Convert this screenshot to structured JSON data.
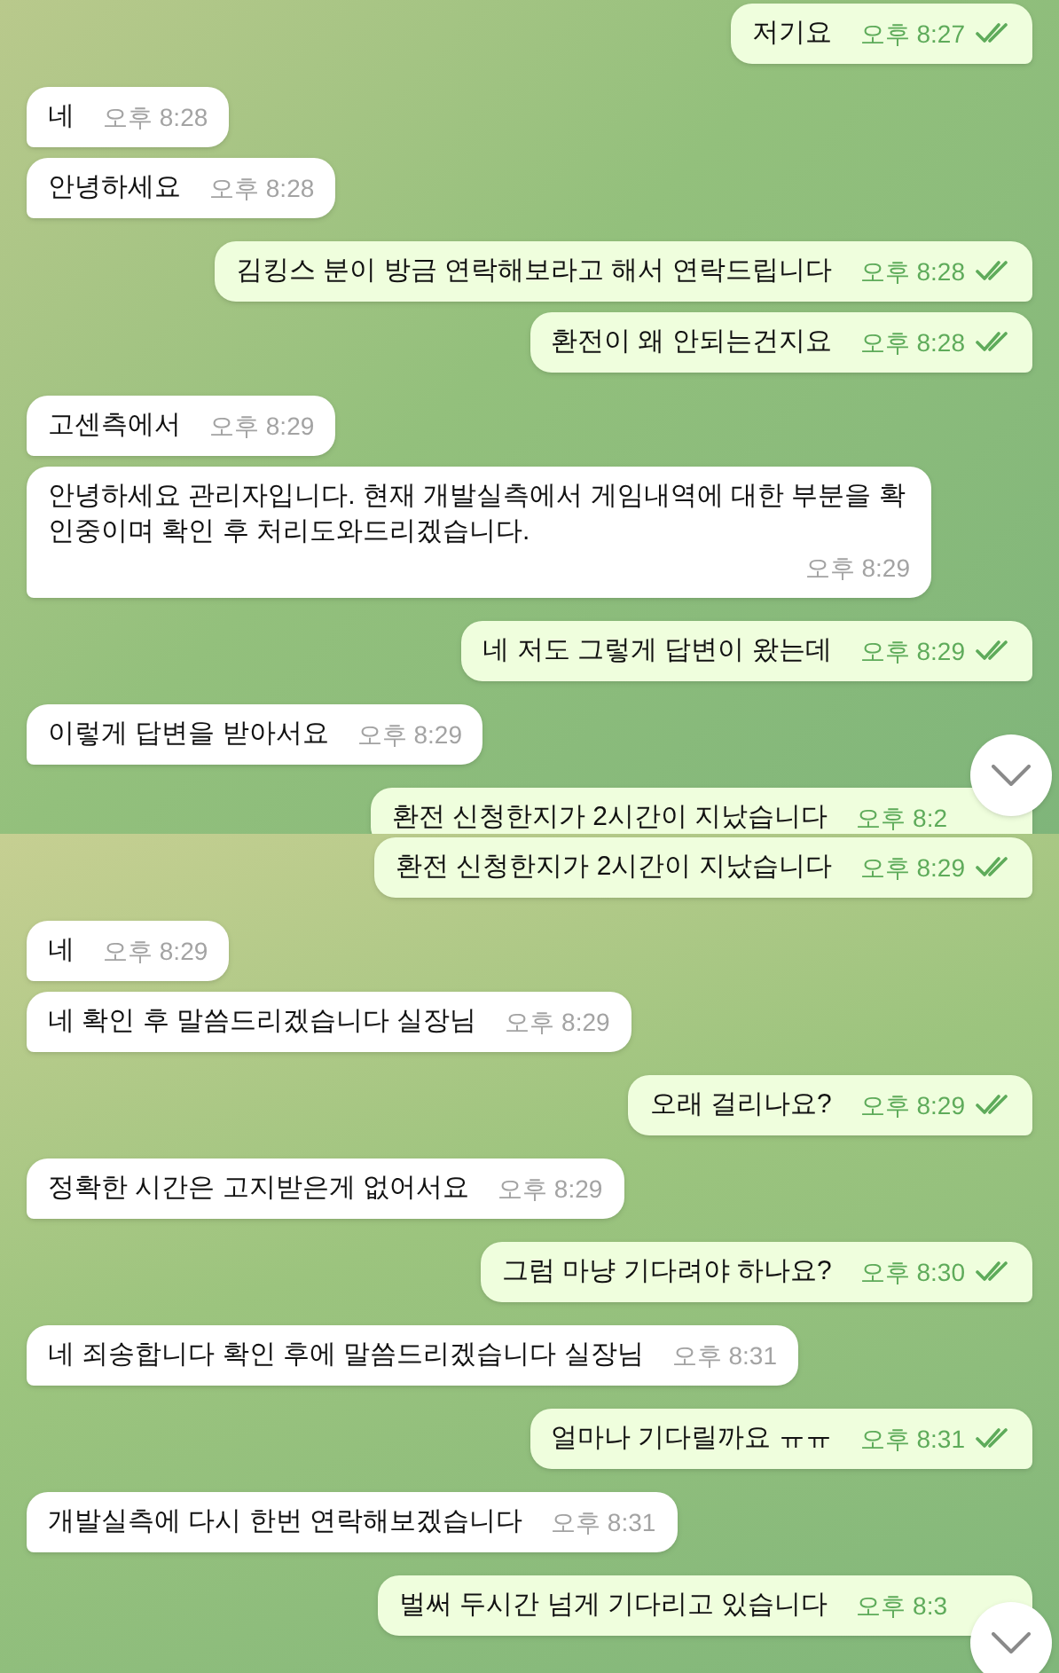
{
  "panels": [
    {
      "scroll_button": true,
      "messages": [
        {
          "kind": "out",
          "text": "저기요",
          "time": "오후 8:27",
          "read": true
        },
        {
          "kind": "in",
          "text": "네",
          "time": "오후 8:28"
        },
        {
          "kind": "in",
          "text": "안녕하세요",
          "time": "오후 8:28"
        },
        {
          "kind": "out",
          "text": "김킹스 분이 방금 연락해보라고 해서 연락드립니다",
          "time": "오후 8:28",
          "read": true
        },
        {
          "kind": "out",
          "text": "환전이 왜 안되는건지요",
          "time": "오후 8:28",
          "read": true
        },
        {
          "kind": "in",
          "text": "고센측에서",
          "time": "오후 8:29"
        },
        {
          "kind": "in",
          "text": "안녕하세요 관리자입니다. 현재 개발실측에서 게임내역에 대한 부분을 확인중이며 확인 후 처리도와드리겠습니다.",
          "time": "오후 8:29"
        },
        {
          "kind": "out",
          "text": "네 저도 그렇게 답변이 왔는데",
          "time": "오후 8:29",
          "read": true
        },
        {
          "kind": "in",
          "text": "이렇게 답변을 받아서요",
          "time": "오후 8:29"
        },
        {
          "kind": "out",
          "text": "환전 신청한지가 2시간이 지났습니다",
          "time": "오후 8:2",
          "read": false
        }
      ]
    },
    {
      "scroll_button": true,
      "messages": [
        {
          "kind": "out",
          "text": "환전 신청한지가 2시간이 지났습니다",
          "time": "오후 8:29",
          "read": true
        },
        {
          "kind": "in",
          "text": "네",
          "time": "오후 8:29"
        },
        {
          "kind": "in",
          "text": "네 확인 후 말씀드리겠습니다 실장님",
          "time": "오후 8:29"
        },
        {
          "kind": "out",
          "text": "오래 걸리나요?",
          "time": "오후 8:29",
          "read": true
        },
        {
          "kind": "in",
          "text": "정확한 시간은 고지받은게 없어서요",
          "time": "오후 8:29"
        },
        {
          "kind": "out",
          "text": "그럼 마냥 기다려야 하나요?",
          "time": "오후 8:30",
          "read": true
        },
        {
          "kind": "in",
          "text": "네 죄송합니다 확인 후에 말씀드리겠습니다 실장님",
          "time": "오후 8:31"
        },
        {
          "kind": "out",
          "text": "얼마나 기다릴까요 ㅠㅠ",
          "time": "오후 8:31",
          "read": true
        },
        {
          "kind": "in",
          "text": "개발실측에 다시 한번 연락해보겠습니다",
          "time": "오후 8:31"
        },
        {
          "kind": "out",
          "text": "벌써 두시간 넘게 기다리고 있습니다",
          "time": "오후 8:3",
          "read": false
        }
      ]
    }
  ]
}
